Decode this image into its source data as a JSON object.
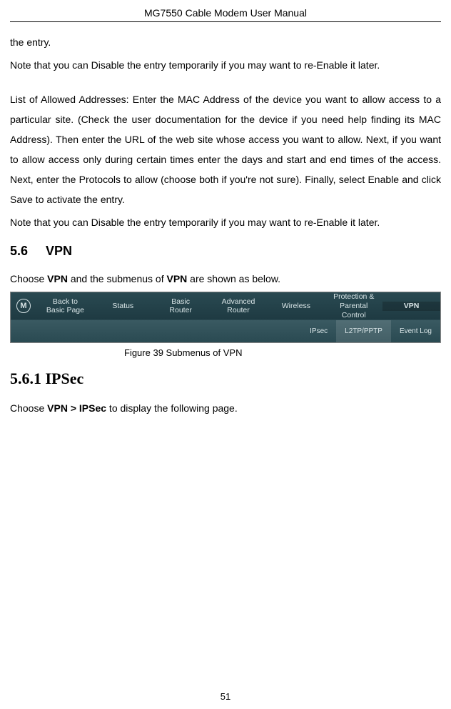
{
  "header": {
    "title": "MG7550 Cable Modem User Manual"
  },
  "paragraphs": {
    "p1": "the entry.",
    "p2": "Note that you can Disable the entry temporarily if you may want to re-Enable it later.",
    "p3": "List of Allowed Addresses: Enter the MAC Address of the device you want to allow access to a particular site. (Check the user documentation for the device if you need help finding its MAC Address). Then enter the URL of the web site whose access you want to allow. Next, if you want to allow access only during certain times enter the days and start and end times of the access. Next, enter the Protocols to allow (choose both if you're not sure). Finally, select Enable and click Save to activate the entry.",
    "p4": "Note that you can Disable the entry temporarily if you may want to re-Enable it later."
  },
  "sections": {
    "vpn_heading_prefix": "5.6",
    "vpn_heading_text": "VPN",
    "vpn_intro_pre": "Choose ",
    "vpn_intro_b1": "VPN",
    "vpn_intro_mid": " and the submenus of ",
    "vpn_intro_b2": "VPN",
    "vpn_intro_post": " are shown as below.",
    "ipsec_heading": "5.6.1  IPSec",
    "ipsec_intro_pre": "Choose ",
    "ipsec_intro_b": "VPN > IPSec",
    "ipsec_intro_post": " to display the following page."
  },
  "figure": {
    "caption": "Figure 39 Submenus of VPN",
    "nav": {
      "logo": "M",
      "items": [
        "Back to\nBasic Page",
        "Status",
        "Basic\nRouter",
        "Advanced\nRouter",
        "Wireless",
        "Protection &\nParental Control",
        "VPN"
      ],
      "subitems": [
        "IPsec",
        "L2TP/PPTP",
        "Event Log"
      ]
    }
  },
  "page_number": "51"
}
